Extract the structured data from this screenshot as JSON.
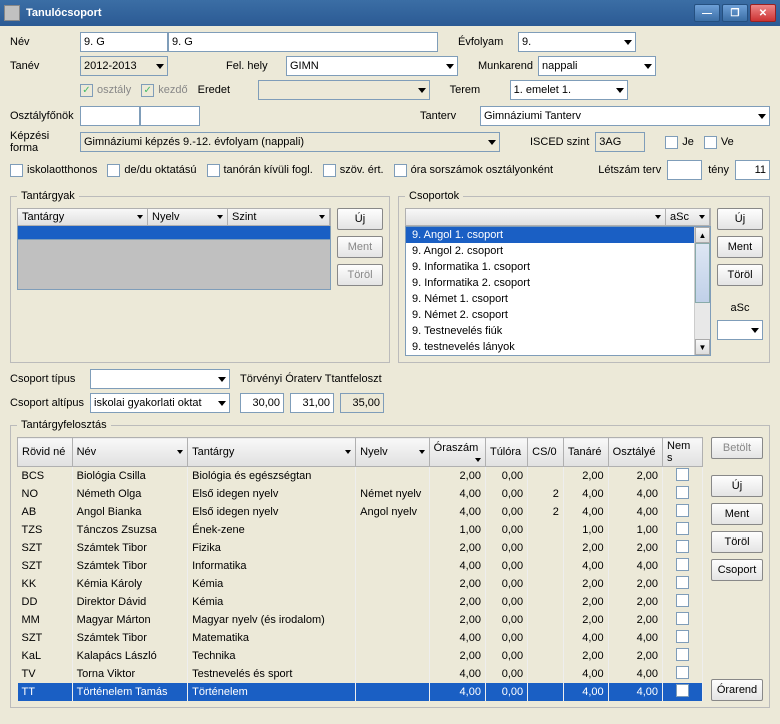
{
  "window": {
    "title": "Tanulócsoport"
  },
  "labels": {
    "nev": "Név",
    "evfolyam": "Évfolyam",
    "tanev": "Tanév",
    "felhely": "Fel. hely",
    "munkarend": "Munkarend",
    "eredet": "Eredet",
    "terem": "Terem",
    "osztaly": "osztály",
    "kezdo": "kezdő",
    "osztalyfonok": "Osztályfőnök",
    "tanterv": "Tanterv",
    "kepzesi": "Képzési forma",
    "isced": "ISCED szint",
    "je": "Je",
    "ve": "Ve",
    "iskolaotthonos": "iskolaotthonos",
    "dedu": "de/du oktatású",
    "tanoran": "tanórán kívüli fogl.",
    "szov": "szöv. ért.",
    "orasor": "óra sorszámok osztályonként",
    "letszamterv": "Létszám terv",
    "teny": "tény",
    "tantargyak": "Tantárgyak",
    "csoportok": "Csoportok",
    "csoporttipus": "Csoport típus",
    "torvenyi": "Törvényi Óraterv Ttantfeloszt",
    "csoportalt": "Csoport altípus",
    "tantargyfel": "Tantárgyfelosztás"
  },
  "fields": {
    "nev1": "9. G",
    "nev2": "9. G",
    "evfolyam": "9.",
    "tanev": "2012-2013",
    "felhely": "GIMN",
    "munkarend": "nappali",
    "eredet": "",
    "terem": "1. emelet 1.",
    "osztalyfonok1": "",
    "osztalyfonok2": "",
    "tanterv": "Gimnáziumi Tanterv",
    "kepzesi": "Gimnáziumi képzés 9.-12. évfolyam (nappali)",
    "isced": "3AG",
    "letszamterv": "",
    "teny": "11",
    "csoportalt": "iskolai gyakorlati oktat",
    "num1": "30,00",
    "num2": "31,00",
    "num3": "35,00"
  },
  "btns": {
    "uj": "Új",
    "ment": "Ment",
    "torol": "Töröl",
    "asc": "aSc",
    "betolt": "Betölt",
    "csoport": "Csoport",
    "orarend": "Órarend"
  },
  "tgHead": {
    "tantargy": "Tantárgy",
    "nyelv": "Nyelv",
    "szint": "Szint"
  },
  "csHead": {
    "blank": "",
    "asc": "aSc"
  },
  "csItems": [
    "9. Angol 1. csoport",
    "9. Angol 2. csoport",
    "9. Informatika 1. csoport",
    "9. Informatika 2. csoport",
    "9. Német 1. csoport",
    "9. Német 2. csoport",
    "9. Testnevelés fiúk",
    "9. testnevelés lányok"
  ],
  "tfHead": {
    "rovid": "Rövid né",
    "nev": "Név",
    "tantargy": "Tantárgy",
    "nyelv": "Nyelv",
    "oraszam": "Óraszám",
    "tulora": "Túlóra",
    "cs0": "CS/0",
    "tanare": "Tanáré",
    "osztalye": "Osztályé",
    "nems": "Nem s"
  },
  "tfRows": [
    {
      "r": "BCS",
      "n": "Biológia Csilla",
      "t": "Biológia és egészségtan",
      "ny": "",
      "o": "2,00",
      "tu": "0,00",
      "cs": "",
      "ta": "2,00",
      "os": "2,00"
    },
    {
      "r": "NO",
      "n": "Németh Olga",
      "t": "Első idegen nyelv",
      "ny": "Német nyelv",
      "o": "4,00",
      "tu": "0,00",
      "cs": "2",
      "ta": "4,00",
      "os": "4,00"
    },
    {
      "r": "AB",
      "n": "Angol Bianka",
      "t": "Első idegen nyelv",
      "ny": "Angol nyelv",
      "o": "4,00",
      "tu": "0,00",
      "cs": "2",
      "ta": "4,00",
      "os": "4,00"
    },
    {
      "r": "TZS",
      "n": "Tánczos Zsuzsa",
      "t": "Ének-zene",
      "ny": "",
      "o": "1,00",
      "tu": "0,00",
      "cs": "",
      "ta": "1,00",
      "os": "1,00"
    },
    {
      "r": "SZT",
      "n": "Számtek Tibor",
      "t": "Fizika",
      "ny": "",
      "o": "2,00",
      "tu": "0,00",
      "cs": "",
      "ta": "2,00",
      "os": "2,00"
    },
    {
      "r": "SZT",
      "n": "Számtek Tibor",
      "t": "Informatika",
      "ny": "",
      "o": "4,00",
      "tu": "0,00",
      "cs": "",
      "ta": "4,00",
      "os": "4,00"
    },
    {
      "r": "KK",
      "n": "Kémia Károly",
      "t": "Kémia",
      "ny": "",
      "o": "2,00",
      "tu": "0,00",
      "cs": "",
      "ta": "2,00",
      "os": "2,00"
    },
    {
      "r": "DD",
      "n": "Direktor Dávid",
      "t": "Kémia",
      "ny": "",
      "o": "2,00",
      "tu": "0,00",
      "cs": "",
      "ta": "2,00",
      "os": "2,00"
    },
    {
      "r": "MM",
      "n": "Magyar Márton",
      "t": "Magyar nyelv (és irodalom)",
      "ny": "",
      "o": "2,00",
      "tu": "0,00",
      "cs": "",
      "ta": "2,00",
      "os": "2,00"
    },
    {
      "r": "SZT",
      "n": "Számtek Tibor",
      "t": "Matematika",
      "ny": "",
      "o": "4,00",
      "tu": "0,00",
      "cs": "",
      "ta": "4,00",
      "os": "4,00"
    },
    {
      "r": "KaL",
      "n": "Kalapács László",
      "t": "Technika",
      "ny": "",
      "o": "2,00",
      "tu": "0,00",
      "cs": "",
      "ta": "2,00",
      "os": "2,00"
    },
    {
      "r": "TV",
      "n": "Torna Viktor",
      "t": "Testnevelés és sport",
      "ny": "",
      "o": "4,00",
      "tu": "0,00",
      "cs": "",
      "ta": "4,00",
      "os": "4,00"
    },
    {
      "r": "TT",
      "n": "Történelem Tamás",
      "t": "Történelem",
      "ny": "",
      "o": "4,00",
      "tu": "0,00",
      "cs": "",
      "ta": "4,00",
      "os": "4,00"
    }
  ]
}
